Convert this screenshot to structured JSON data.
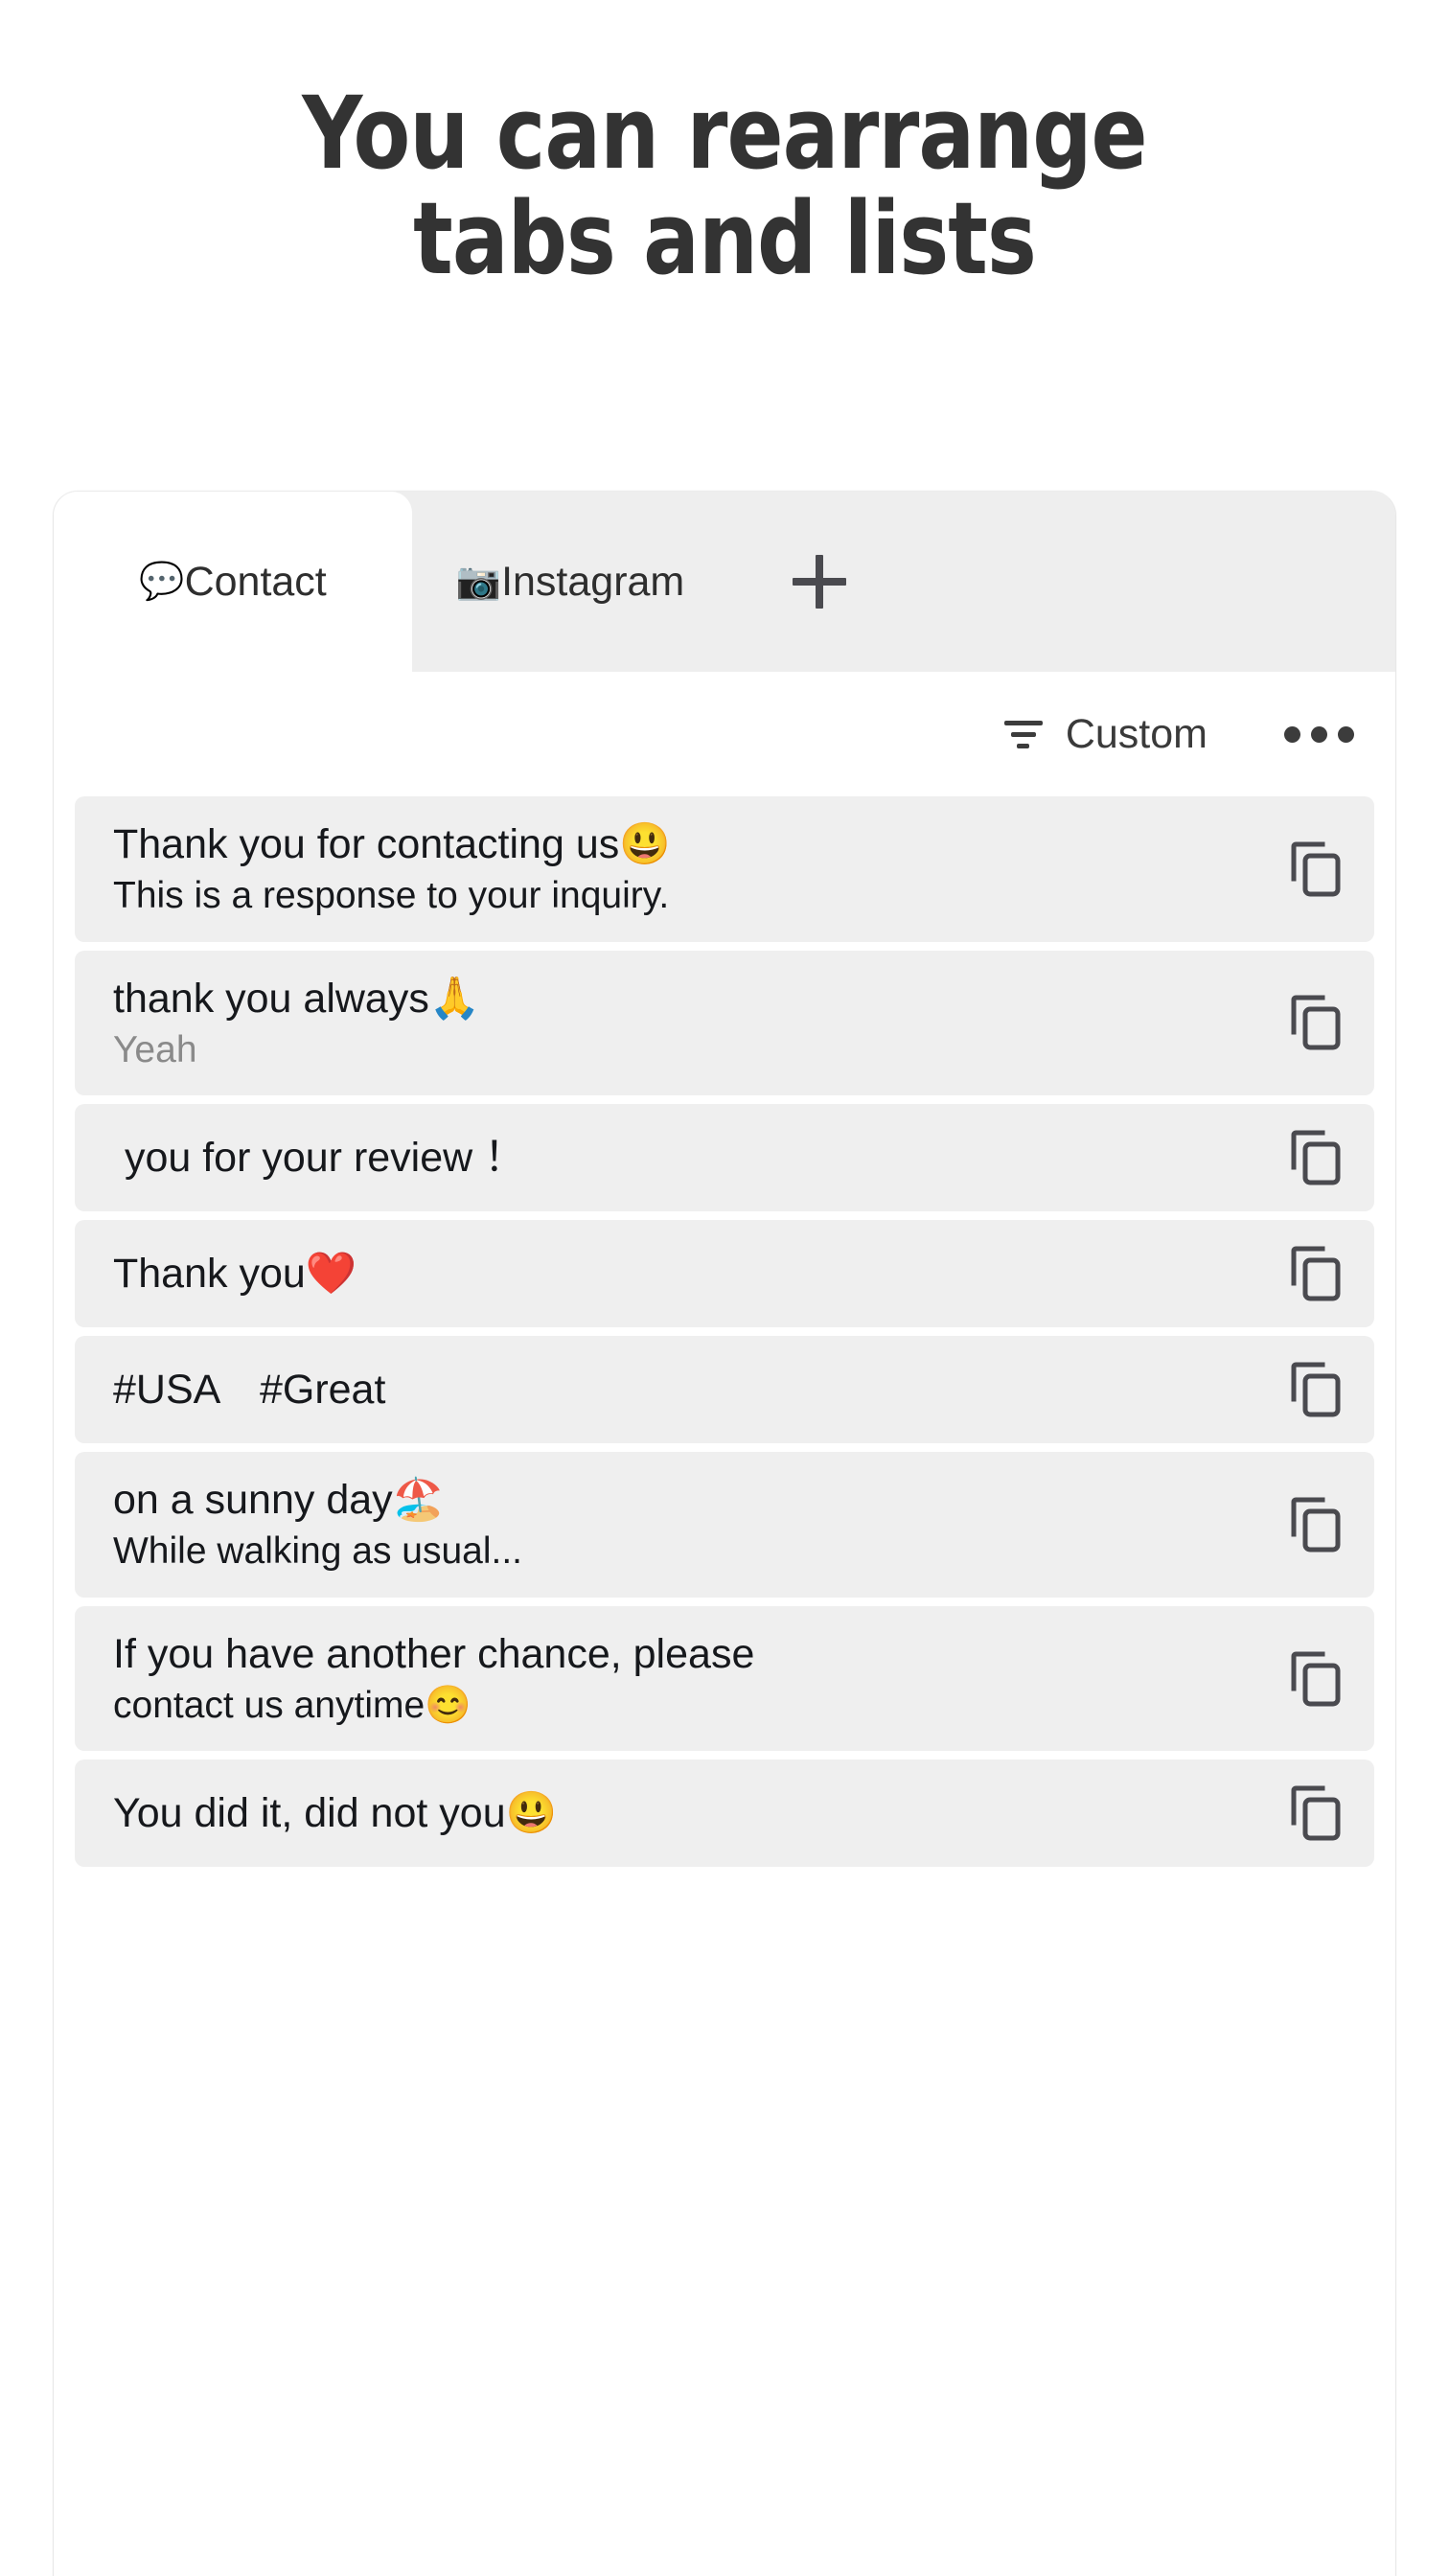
{
  "headline": {
    "line1": "You can rearrange",
    "line2": "tabs and lists"
  },
  "tabs": {
    "items": [
      {
        "emoji": "💬",
        "label": "Contact",
        "active": true
      },
      {
        "emoji": "📷",
        "label": "Instagram",
        "active": false
      }
    ],
    "add_label": "+"
  },
  "toolbar": {
    "sort_label": "Custom",
    "sort_icon": "filter-sort-icon",
    "overflow_icon": "more-horizontal-icon"
  },
  "list": {
    "copy_icon": "copy-icon",
    "rows": [
      {
        "title": "Thank you for contacting us😃",
        "sub": "This is a response to your inquiry.",
        "sub_muted": false
      },
      {
        "title": "thank you always🙏",
        "sub": "Yeah",
        "sub_muted": true
      },
      {
        "title": " you for your review ！",
        "sub": "",
        "sub_muted": false
      },
      {
        "title": "Thank you❤️",
        "sub": "",
        "sub_muted": false
      },
      {
        "title": "#USA　#Great",
        "sub": "",
        "sub_muted": false
      },
      {
        "title": "on a sunny day🏖️",
        "sub": "While walking as usual...",
        "sub_muted": false
      },
      {
        "title": "If you have another chance, please",
        "sub": "contact us anytime😊",
        "sub_muted": false
      },
      {
        "title": "You did it, did not you😃",
        "sub": "",
        "sub_muted": false
      }
    ]
  },
  "colors": {
    "headline": "#333333",
    "tab_strip_bg": "#eeeeee",
    "row_bg": "#efefef",
    "card_bg": "#ffffff",
    "text": "#16181c",
    "muted_text": "#8a8a8a"
  }
}
